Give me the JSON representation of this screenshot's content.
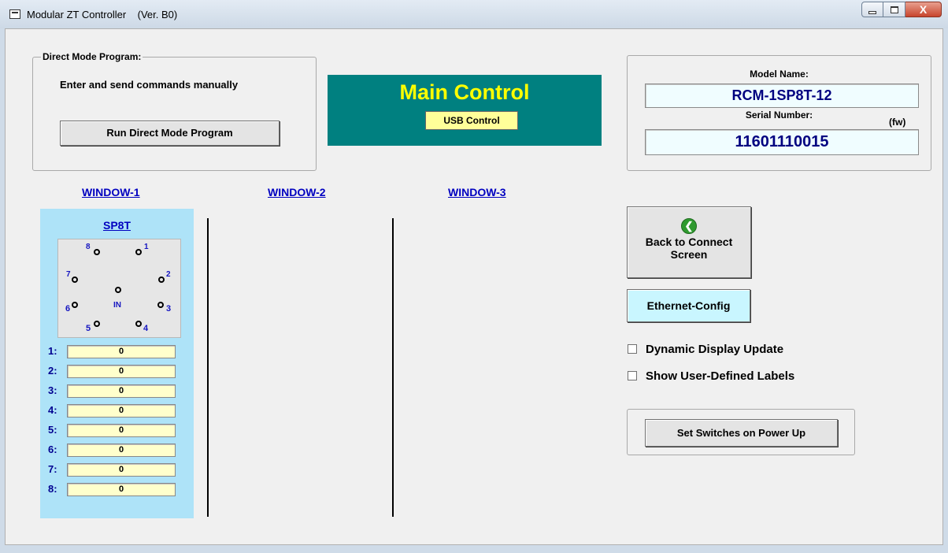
{
  "window": {
    "title": "Modular ZT Controller    (Ver. B0)",
    "close_glyph": "X"
  },
  "direct_mode": {
    "legend": "Direct Mode Program:",
    "description": "Enter and send commands manually",
    "run_button": "Run Direct Mode Program"
  },
  "main_control": {
    "title": "Main Control",
    "status": "USB Control"
  },
  "model_info": {
    "model_label": "Model Name:",
    "model_value": "RCM-1SP8T-12",
    "serial_label": "Serial Number:",
    "fw_label": "(fw)",
    "serial_value": "11601110015"
  },
  "windows": {
    "window1": "WINDOW-1",
    "window2": "WINDOW-2",
    "window3": "WINDOW-3"
  },
  "switch": {
    "type_link": "SP8T",
    "in_label": "IN",
    "ports": {
      "p1": "1",
      "p2": "2",
      "p3": "3",
      "p4": "4",
      "p5": "5",
      "p6": "6",
      "p7": "7",
      "p8": "8"
    },
    "rows": [
      {
        "label": "1:",
        "value": "0"
      },
      {
        "label": "2:",
        "value": "0"
      },
      {
        "label": "3:",
        "value": "0"
      },
      {
        "label": "4:",
        "value": "0"
      },
      {
        "label": "5:",
        "value": "0"
      },
      {
        "label": "6:",
        "value": "0"
      },
      {
        "label": "7:",
        "value": "0"
      },
      {
        "label": "8:",
        "value": "0"
      }
    ]
  },
  "right_panel": {
    "back_button_line1": "Back to Connect",
    "back_button_line2": "Screen",
    "back_icon": "green-circle-left-arrow-icon",
    "ethernet_button": "Ethernet-Config",
    "dynamic_update": {
      "label": "Dynamic Display Update",
      "checked": false
    },
    "user_labels": {
      "label": "Show User-Defined Labels",
      "checked": false
    },
    "power_up_button": "Set Switches on Power Up"
  },
  "colors": {
    "main_control_bg": "#008080",
    "main_control_text": "#ffff00",
    "usb_badge_bg": "#ffff99",
    "link": "#0000c0",
    "switch_panel_bg": "#aee3f8",
    "ethernet_button_bg": "#c9f6ff",
    "row_field_bg": "#ffffcc"
  }
}
